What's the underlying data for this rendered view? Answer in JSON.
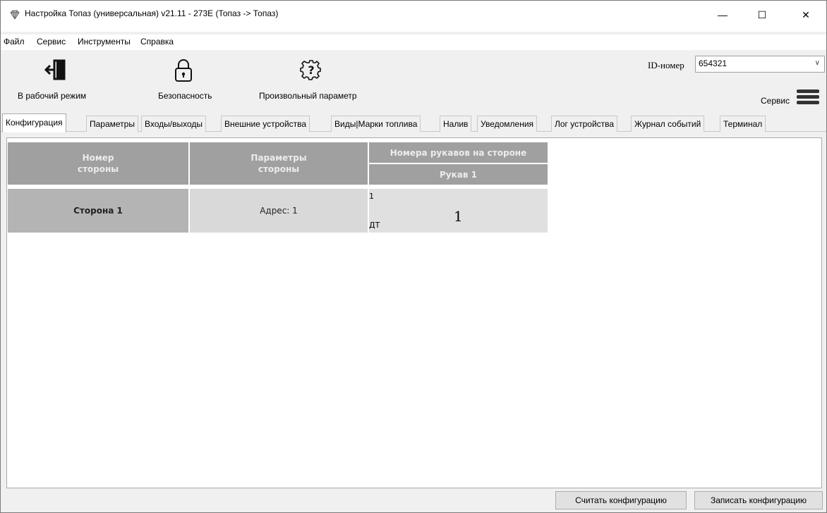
{
  "window": {
    "title": "Настройка Топаз (универсальная) v21.11 - 273E (Топаз -> Топаз)",
    "min": "—",
    "max": "☐",
    "close": "✕"
  },
  "menu": [
    "Файл",
    "Сервис",
    "Инструменты",
    "Справка"
  ],
  "toolbar": {
    "work_mode": "В рабочий режим",
    "security": "Безопасность",
    "custom_param": "Произвольный параметр",
    "id_label": "ID-номер",
    "id_value": "654321",
    "service_label": "Сервис"
  },
  "tabs": [
    "Конфигурация",
    "Параметры",
    "Входы/выходы",
    "Внешние устройства",
    "Виды|Марки топлива",
    "Налив",
    "Уведомления",
    "Лог устройства",
    "Журнал событий",
    "Терминал"
  ],
  "grid": {
    "col_side_number": "Номер\nстороны",
    "col_side_params": "Параметры\nстороны",
    "col_hoses_group": "Номера рукавов на стороне",
    "col_hose_1": "Рукав 1",
    "rows": [
      {
        "side": "Сторона 1",
        "params": "Адрес: 1",
        "hose_number": "1",
        "hose_fuel": "ДТ",
        "hose_display": "1"
      }
    ]
  },
  "buttons": {
    "read_config": "Считать конфигурацию",
    "write_config": "Записать конфигурацию"
  },
  "colors": {
    "header_bg": "#a0a0a0",
    "side_cell_bg": "#b4b4b4",
    "param_cell_bg": "#d9d9d9"
  }
}
